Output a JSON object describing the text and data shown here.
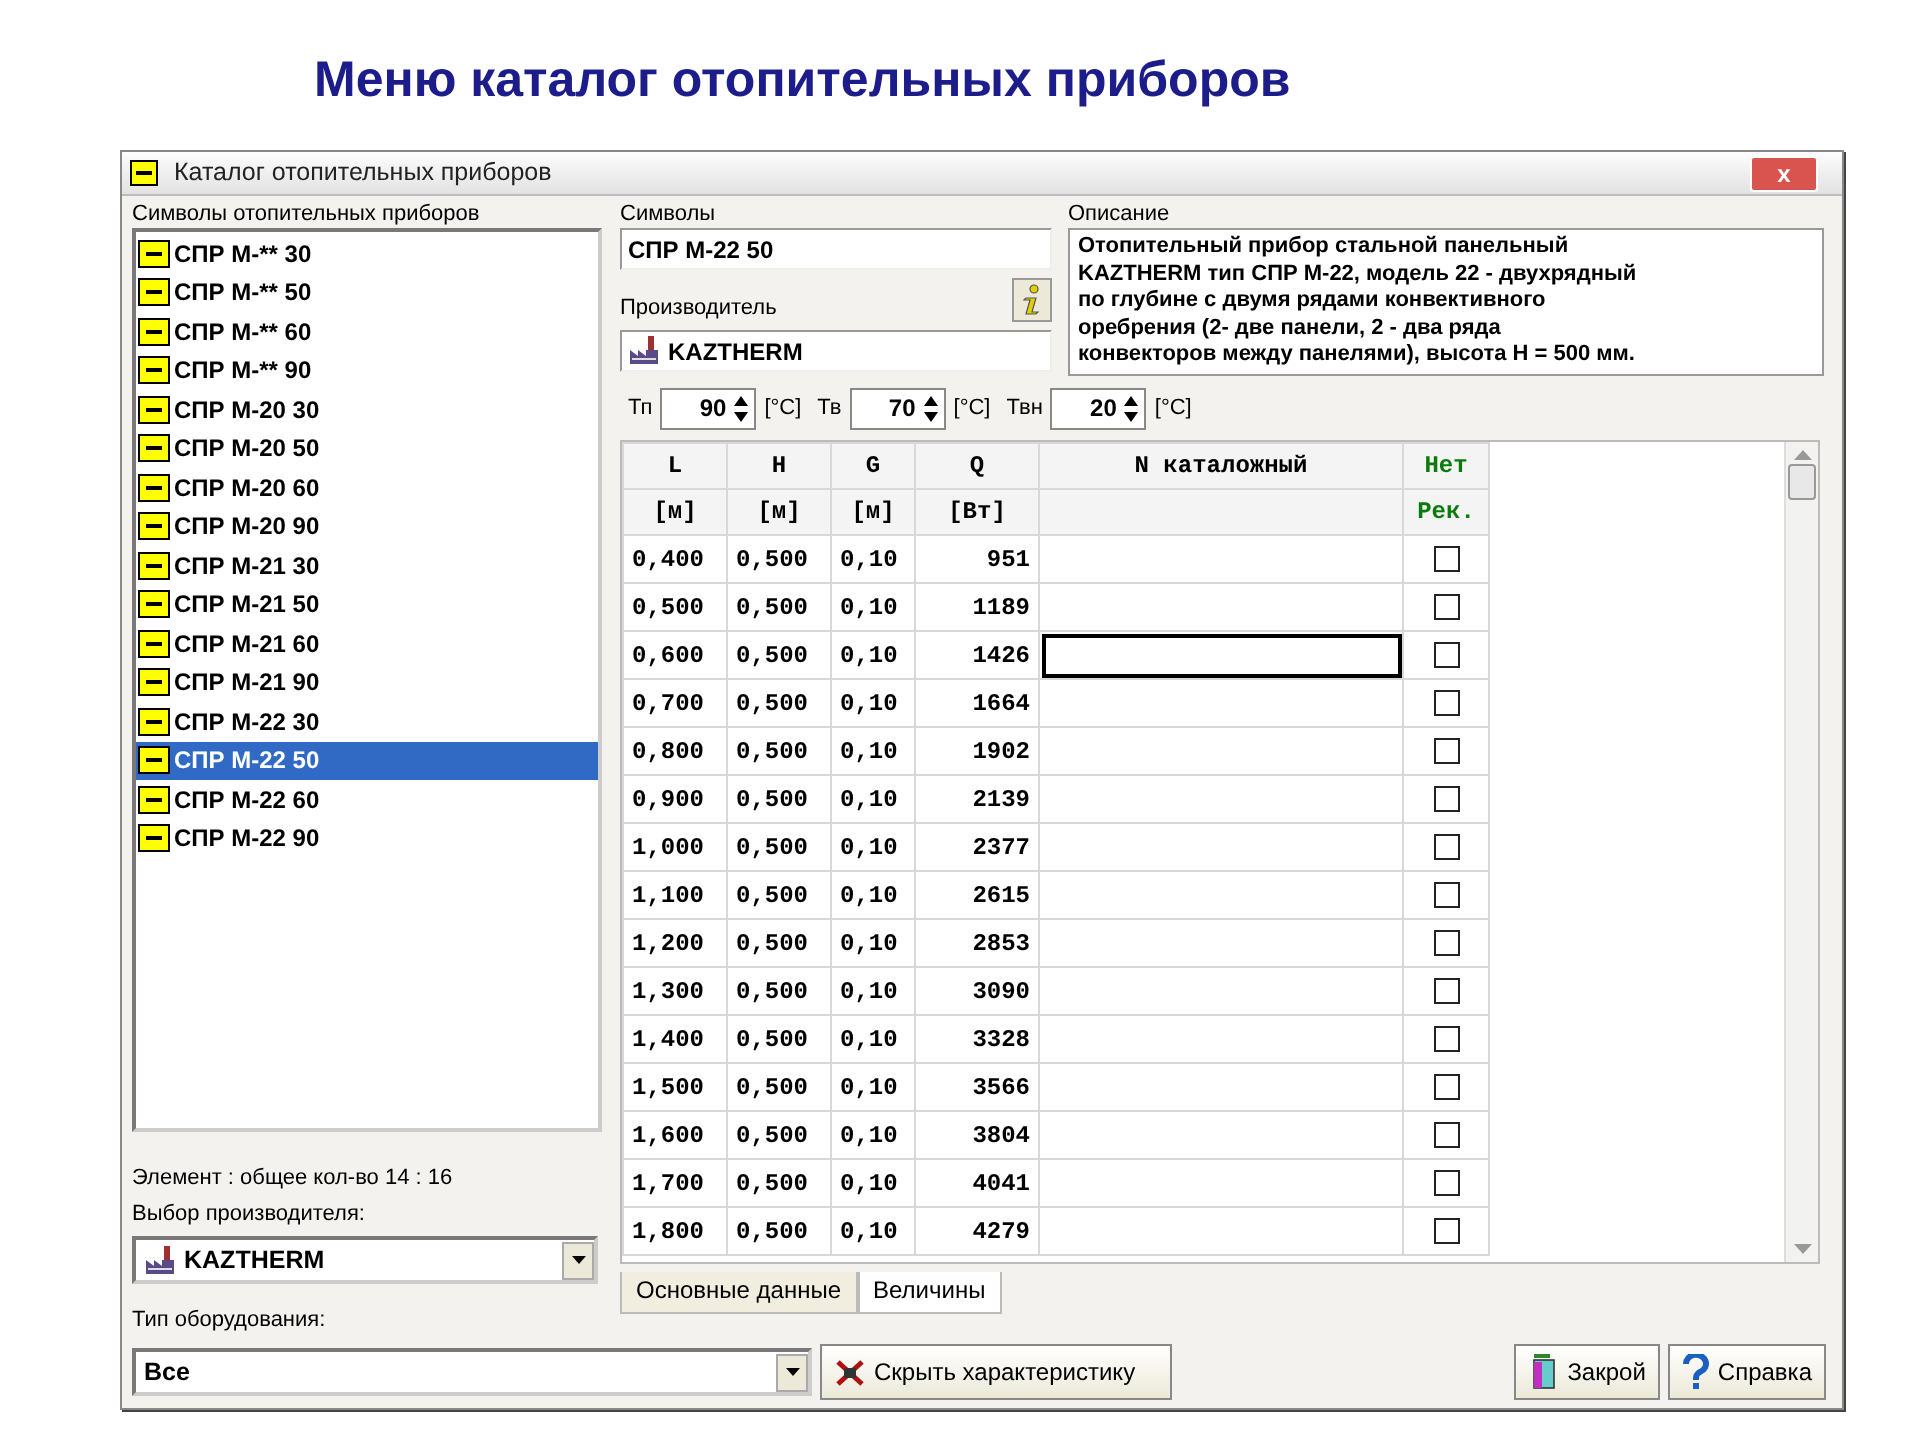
{
  "slide_title": "Меню каталог отопительных приборов",
  "window": {
    "title": "Каталог отопительных приборов",
    "close": "x"
  },
  "symbols_list": {
    "label": "Символы отопительных приборов",
    "items": [
      {
        "label": "СПР М-** 30",
        "selected": false
      },
      {
        "label": "СПР М-** 50",
        "selected": false
      },
      {
        "label": "СПР М-** 60",
        "selected": false
      },
      {
        "label": "СПР М-** 90",
        "selected": false
      },
      {
        "label": "СПР М-20 30",
        "selected": false
      },
      {
        "label": "СПР М-20 50",
        "selected": false
      },
      {
        "label": "СПР М-20 60",
        "selected": false
      },
      {
        "label": "СПР М-20 90",
        "selected": false
      },
      {
        "label": "СПР М-21 30",
        "selected": false
      },
      {
        "label": "СПР М-21 50",
        "selected": false
      },
      {
        "label": "СПР М-21 60",
        "selected": false
      },
      {
        "label": "СПР М-21 90",
        "selected": false
      },
      {
        "label": "СПР М-22 30",
        "selected": false
      },
      {
        "label": "СПР М-22 50",
        "selected": true
      },
      {
        "label": "СПР М-22 60",
        "selected": false
      },
      {
        "label": "СПР М-22 90",
        "selected": false
      }
    ]
  },
  "element_count": "Элемент : общее кол-во 14 : 16",
  "manufacturer_select": {
    "label": "Выбор производителя:",
    "value": "KAZTHERM"
  },
  "symbol": {
    "label": "Символы",
    "value": "СПР М-22 50"
  },
  "manufacturer": {
    "label": "Производитель",
    "value": "KAZTHERM"
  },
  "description": {
    "label": "Описание",
    "value": "Отопительный прибор стальной панельный\nKAZTHERM тип СПР М-22, модель 22 - двухрядный\nпо глубине с двумя рядами конвективного\nоребрения (2- две панели, 2 - два ряда\nконвекторов между панелями), высота Н = 500 мм."
  },
  "temperatures": [
    {
      "label": "Тп",
      "value": "90",
      "unit": "[°C]"
    },
    {
      "label": "Тв",
      "value": "70",
      "unit": "[°C]"
    },
    {
      "label": "Твн",
      "value": "20",
      "unit": "[°C]"
    }
  ],
  "table": {
    "columns": [
      {
        "name": "L",
        "unit": "[м]"
      },
      {
        "name": "H",
        "unit": "[м]"
      },
      {
        "name": "G",
        "unit": "[м]"
      },
      {
        "name": "Q",
        "unit": "[Вт]"
      },
      {
        "name": "N каталожный"
      },
      {
        "name": "Нет",
        "unit": "Рек."
      }
    ],
    "rows": [
      {
        "cells": [
          "0,400",
          "0,500",
          "0,10",
          "951"
        ],
        "focused": false,
        "checked": false
      },
      {
        "cells": [
          "0,500",
          "0,500",
          "0,10",
          "1189"
        ],
        "focused": false,
        "checked": false
      },
      {
        "cells": [
          "0,600",
          "0,500",
          "0,10",
          "1426"
        ],
        "focused": true,
        "checked": false
      },
      {
        "cells": [
          "0,700",
          "0,500",
          "0,10",
          "1664"
        ],
        "focused": false,
        "checked": false
      },
      {
        "cells": [
          "0,800",
          "0,500",
          "0,10",
          "1902"
        ],
        "focused": false,
        "checked": false
      },
      {
        "cells": [
          "0,900",
          "0,500",
          "0,10",
          "2139"
        ],
        "focused": false,
        "checked": false
      },
      {
        "cells": [
          "1,000",
          "0,500",
          "0,10",
          "2377"
        ],
        "focused": false,
        "checked": false
      },
      {
        "cells": [
          "1,100",
          "0,500",
          "0,10",
          "2615"
        ],
        "focused": false,
        "checked": false
      },
      {
        "cells": [
          "1,200",
          "0,500",
          "0,10",
          "2853"
        ],
        "focused": false,
        "checked": false
      },
      {
        "cells": [
          "1,300",
          "0,500",
          "0,10",
          "3090"
        ],
        "focused": false,
        "checked": false
      },
      {
        "cells": [
          "1,400",
          "0,500",
          "0,10",
          "3328"
        ],
        "focused": false,
        "checked": false
      },
      {
        "cells": [
          "1,500",
          "0,500",
          "0,10",
          "3566"
        ],
        "focused": false,
        "checked": false
      },
      {
        "cells": [
          "1,600",
          "0,500",
          "0,10",
          "3804"
        ],
        "focused": false,
        "checked": false
      },
      {
        "cells": [
          "1,700",
          "0,500",
          "0,10",
          "4041"
        ],
        "focused": false,
        "checked": false
      },
      {
        "cells": [
          "1,800",
          "0,500",
          "0,10",
          "4279"
        ],
        "focused": false,
        "checked": false
      }
    ]
  },
  "tabs": [
    {
      "label": "Основные данные",
      "selected": false
    },
    {
      "label": "Величины",
      "selected": true
    }
  ],
  "equipment_type": {
    "label": "Тип оборудования:",
    "value": "Все"
  },
  "buttons": [
    {
      "kind": "hide",
      "label": "Скрыть характеристику"
    },
    {
      "kind": "close",
      "label": "Закрой"
    },
    {
      "kind": "help",
      "label": "Справка"
    }
  ]
}
